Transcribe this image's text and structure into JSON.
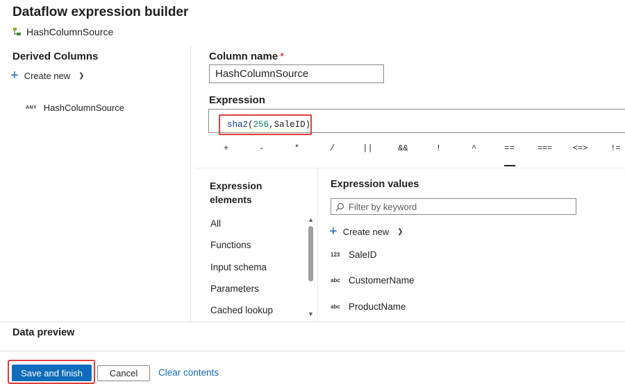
{
  "header": {
    "title": "Dataflow expression builder",
    "subtitle": "HashColumnSource"
  },
  "left_panel": {
    "title": "Derived Columns",
    "create_new": "Create new",
    "columns": [
      {
        "type": "ANY",
        "name": "HashColumnSource"
      }
    ]
  },
  "column_name": {
    "label": "Column name",
    "required_marker": "*",
    "value": "HashColumnSource"
  },
  "expression": {
    "label": "Expression",
    "function": "sha2",
    "open_paren": "(",
    "arg1": "256",
    "comma": ",",
    "arg2": "SaleID",
    "close_paren": ")"
  },
  "operators": [
    "+",
    "-",
    "*",
    "/",
    "||",
    "&&",
    "!",
    "^",
    "==",
    "===",
    "<=>",
    "!="
  ],
  "operator_active": "==",
  "expression_elements": {
    "title": "Expression elements",
    "items": [
      "All",
      "Functions",
      "Input schema",
      "Parameters",
      "Cached lookup"
    ]
  },
  "expression_values": {
    "title": "Expression values",
    "filter_placeholder": "Filter by keyword",
    "create_new": "Create new",
    "items": [
      {
        "type": "123",
        "name": "SaleID"
      },
      {
        "type": "abc",
        "name": "CustomerName"
      },
      {
        "type": "abc",
        "name": "ProductName"
      }
    ]
  },
  "data_preview": {
    "title": "Data preview"
  },
  "footer": {
    "save_label": "Save and finish",
    "cancel_label": "Cancel",
    "clear_label": "Clear contents"
  },
  "colors": {
    "accent": "#0f6cbd",
    "highlight": "#e03c3c"
  }
}
